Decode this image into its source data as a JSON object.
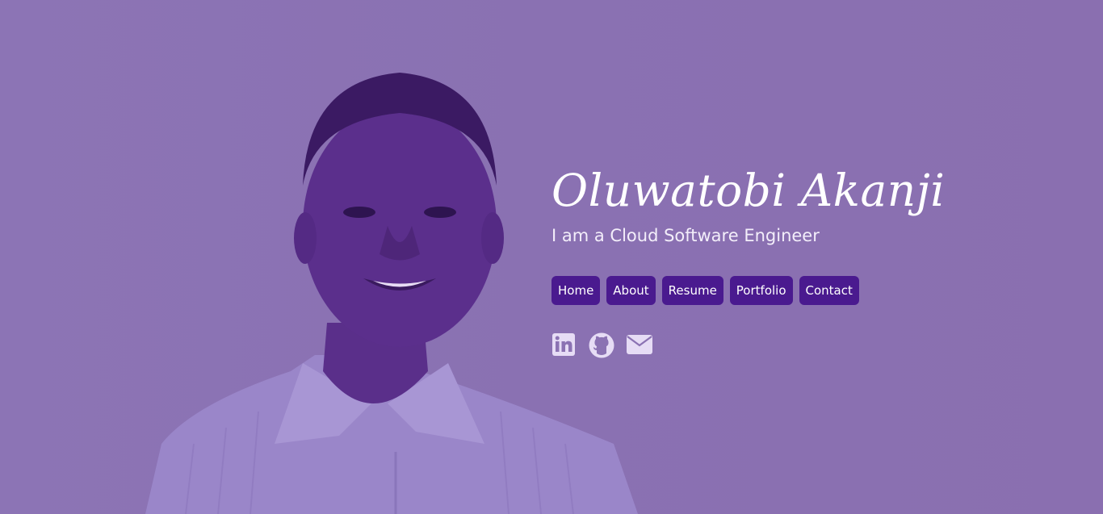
{
  "hero": {
    "name": "Oluwatobi Akanji",
    "tagline": "I am a Cloud Software Engineer"
  },
  "nav": {
    "items": [
      {
        "label": "Home"
      },
      {
        "label": "About"
      },
      {
        "label": "Resume"
      },
      {
        "label": "Portfolio"
      },
      {
        "label": "Contact"
      }
    ]
  },
  "social": {
    "icons": [
      "linkedin-icon",
      "github-icon",
      "envelope-icon"
    ]
  },
  "colors": {
    "overlay": "#8b72b3",
    "nav_button_bg": "#4a1a8f",
    "text": "#ffffff",
    "icon": "#e6dcf5"
  }
}
